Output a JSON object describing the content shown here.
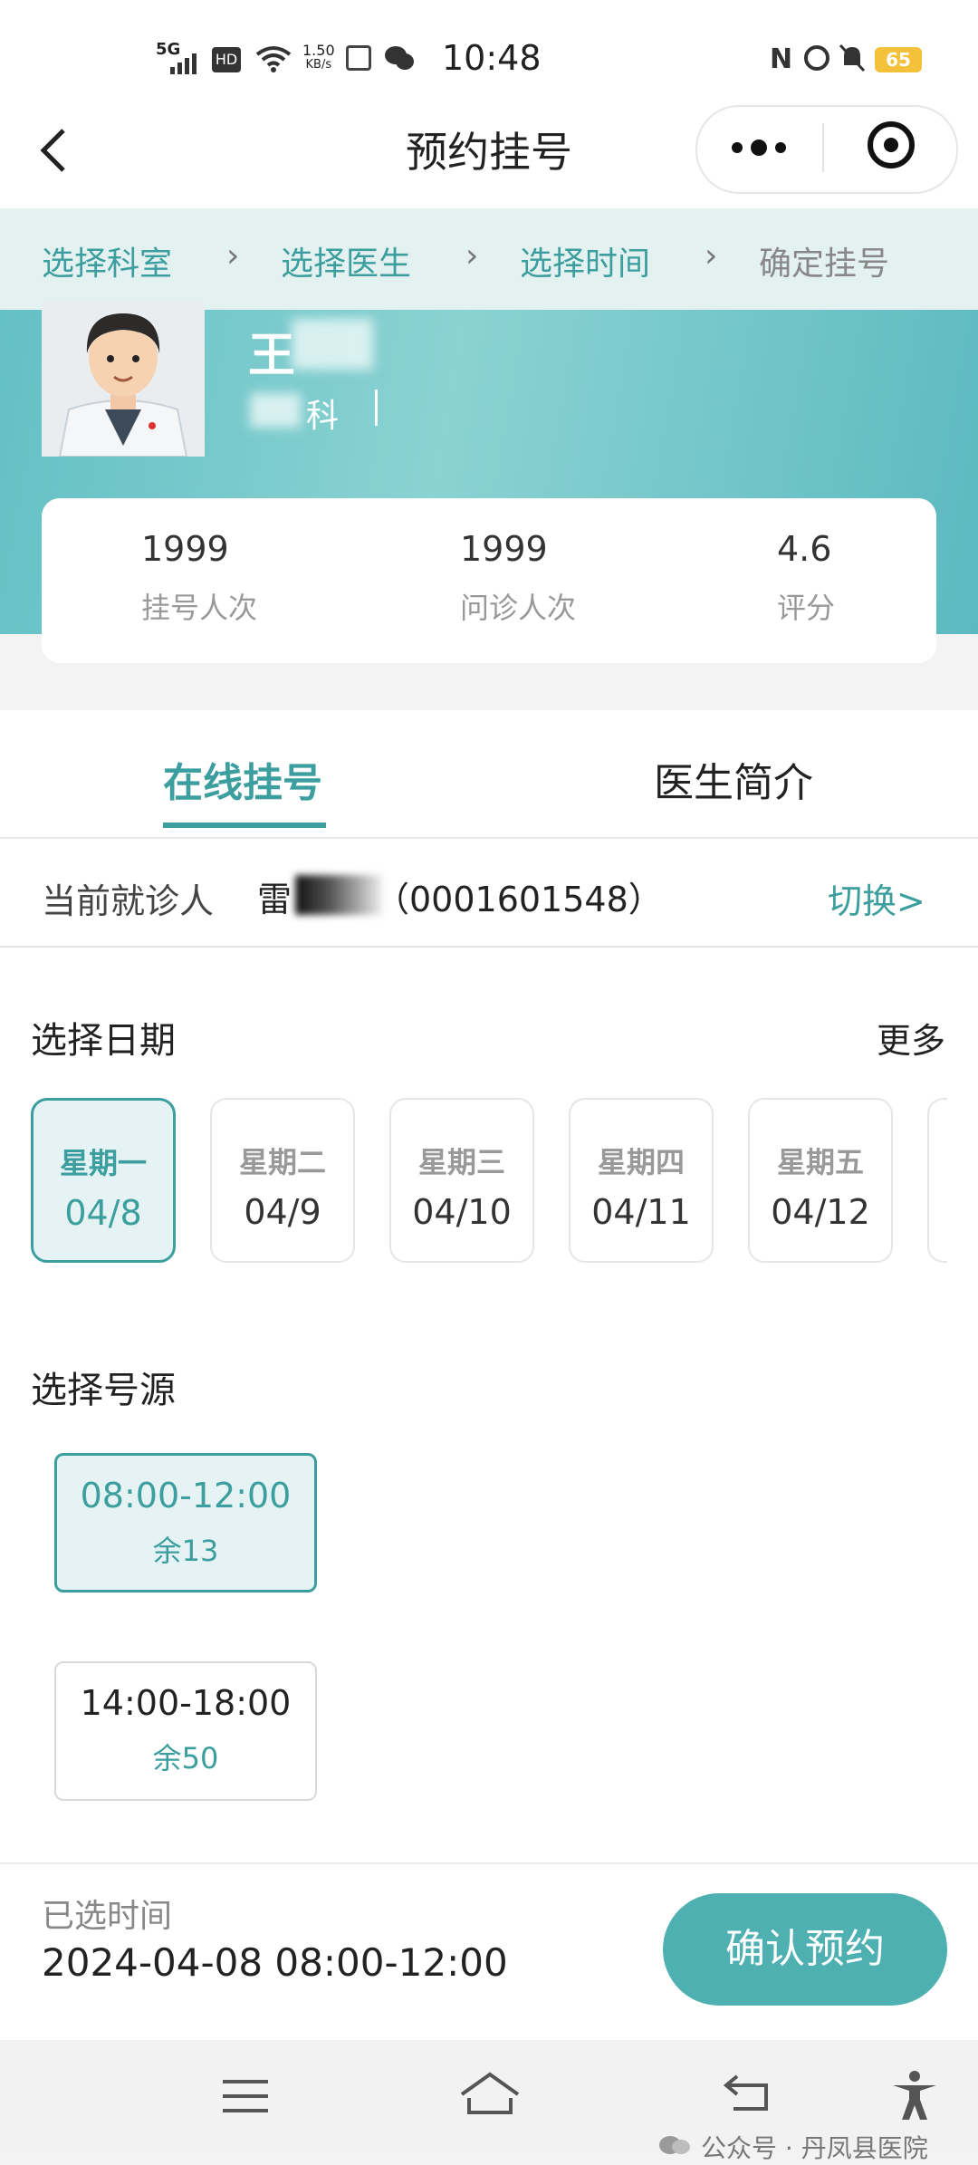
{
  "status_bar": {
    "network": "5G",
    "hd": "HD",
    "speed": "1.50",
    "speed_unit": "KB/s",
    "time": "10:48",
    "battery": "65"
  },
  "nav": {
    "title": "预约挂号",
    "back_icon": "chevron-left-icon",
    "more_icon": "more-dots-icon",
    "close_icon": "target-icon"
  },
  "steps": [
    {
      "label": "选择科室"
    },
    {
      "label": "选择医生"
    },
    {
      "label": "选择时间"
    },
    {
      "label": "确定挂号"
    }
  ],
  "doctor": {
    "name": "王",
    "dept": "科"
  },
  "stats": [
    {
      "value": "1999",
      "label": "挂号人次"
    },
    {
      "value": "1999",
      "label": "问诊人次"
    },
    {
      "value": "4.6",
      "label": "评分"
    }
  ],
  "tabs": [
    {
      "label": "在线挂号"
    },
    {
      "label": "医生简介"
    }
  ],
  "patient": {
    "label": "当前就诊人",
    "name": "雷",
    "id": "（0001601548）",
    "switch": "切换>"
  },
  "date_section": {
    "title": "选择日期",
    "more": "更多",
    "dates": [
      {
        "weekday": "星期一",
        "date": "04/8"
      },
      {
        "weekday": "星期二",
        "date": "04/9"
      },
      {
        "weekday": "星期三",
        "date": "04/10"
      },
      {
        "weekday": "星期四",
        "date": "04/11"
      },
      {
        "weekday": "星期五",
        "date": "04/12"
      }
    ]
  },
  "slot_section": {
    "title": "选择号源",
    "slots": [
      {
        "time": "08:00-12:00",
        "remain": "余13"
      },
      {
        "time": "14:00-18:00",
        "remain": "余50"
      }
    ]
  },
  "bottom": {
    "selected_label": "已选时间",
    "selected_value": "2024-04-08 08:00-12:00",
    "confirm": "确认预约"
  },
  "system_nav": {
    "menu_icon": "menu-icon",
    "home_icon": "home-icon",
    "back_icon": "back-icon",
    "accessibility_icon": "accessibility-icon"
  },
  "watermark": "公众号 · 丹凤县医院",
  "colors": {
    "accent": "#3c9e9e",
    "accent_light": "#e5f3f4",
    "button": "#4fb0b2"
  }
}
